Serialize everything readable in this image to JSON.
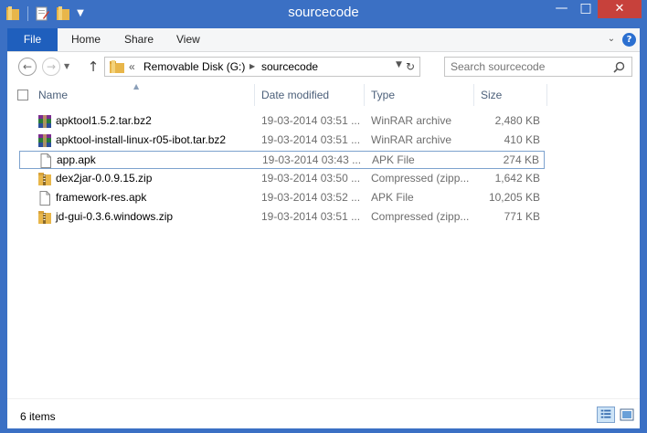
{
  "window": {
    "title": "sourcecode",
    "controls": {
      "minimize": "—",
      "maximize": "□",
      "close": "✕"
    }
  },
  "ribbon": {
    "tabs": [
      {
        "label": "File"
      },
      {
        "label": "Home"
      },
      {
        "label": "Share"
      },
      {
        "label": "View"
      }
    ],
    "help": "?"
  },
  "nav": {
    "breadcrumb": {
      "overflow": "«",
      "items": [
        "Removable Disk (G:)",
        "sourcecode"
      ]
    },
    "search": {
      "placeholder": "Search sourcecode"
    }
  },
  "columns": {
    "name": "Name",
    "date": "Date modified",
    "type": "Type",
    "size": "Size"
  },
  "files": [
    {
      "name": "apktool1.5.2.tar.bz2",
      "date": "19-03-2014 03:51 ...",
      "type": "WinRAR archive",
      "size": "2,480 KB",
      "icon": "winrar-archive-icon"
    },
    {
      "name": "apktool-install-linux-r05-ibot.tar.bz2",
      "date": "19-03-2014 03:51 ...",
      "type": "WinRAR archive",
      "size": "410 KB",
      "icon": "winrar-archive-icon"
    },
    {
      "name": "app.apk",
      "date": "19-03-2014 03:43 ...",
      "type": "APK File",
      "size": "274 KB",
      "icon": "file-icon",
      "selected": true
    },
    {
      "name": "dex2jar-0.0.9.15.zip",
      "date": "19-03-2014 03:50 ...",
      "type": "Compressed (zipp...",
      "size": "1,642 KB",
      "icon": "zip-folder-icon"
    },
    {
      "name": "framework-res.apk",
      "date": "19-03-2014 03:52 ...",
      "type": "APK File",
      "size": "10,205 KB",
      "icon": "file-icon"
    },
    {
      "name": "jd-gui-0.3.6.windows.zip",
      "date": "19-03-2014 03:51 ...",
      "type": "Compressed (zipp...",
      "size": "771 KB",
      "icon": "zip-folder-icon"
    }
  ],
  "status": {
    "item_count": "6 items"
  },
  "colors": {
    "window_frame": "#3b70c4",
    "file_tab": "#1f5fbd",
    "close_button": "#c7413b",
    "selection_border": "#7da2ce",
    "header_text": "#4c607a",
    "secondary_text": "#6d6d6d"
  }
}
